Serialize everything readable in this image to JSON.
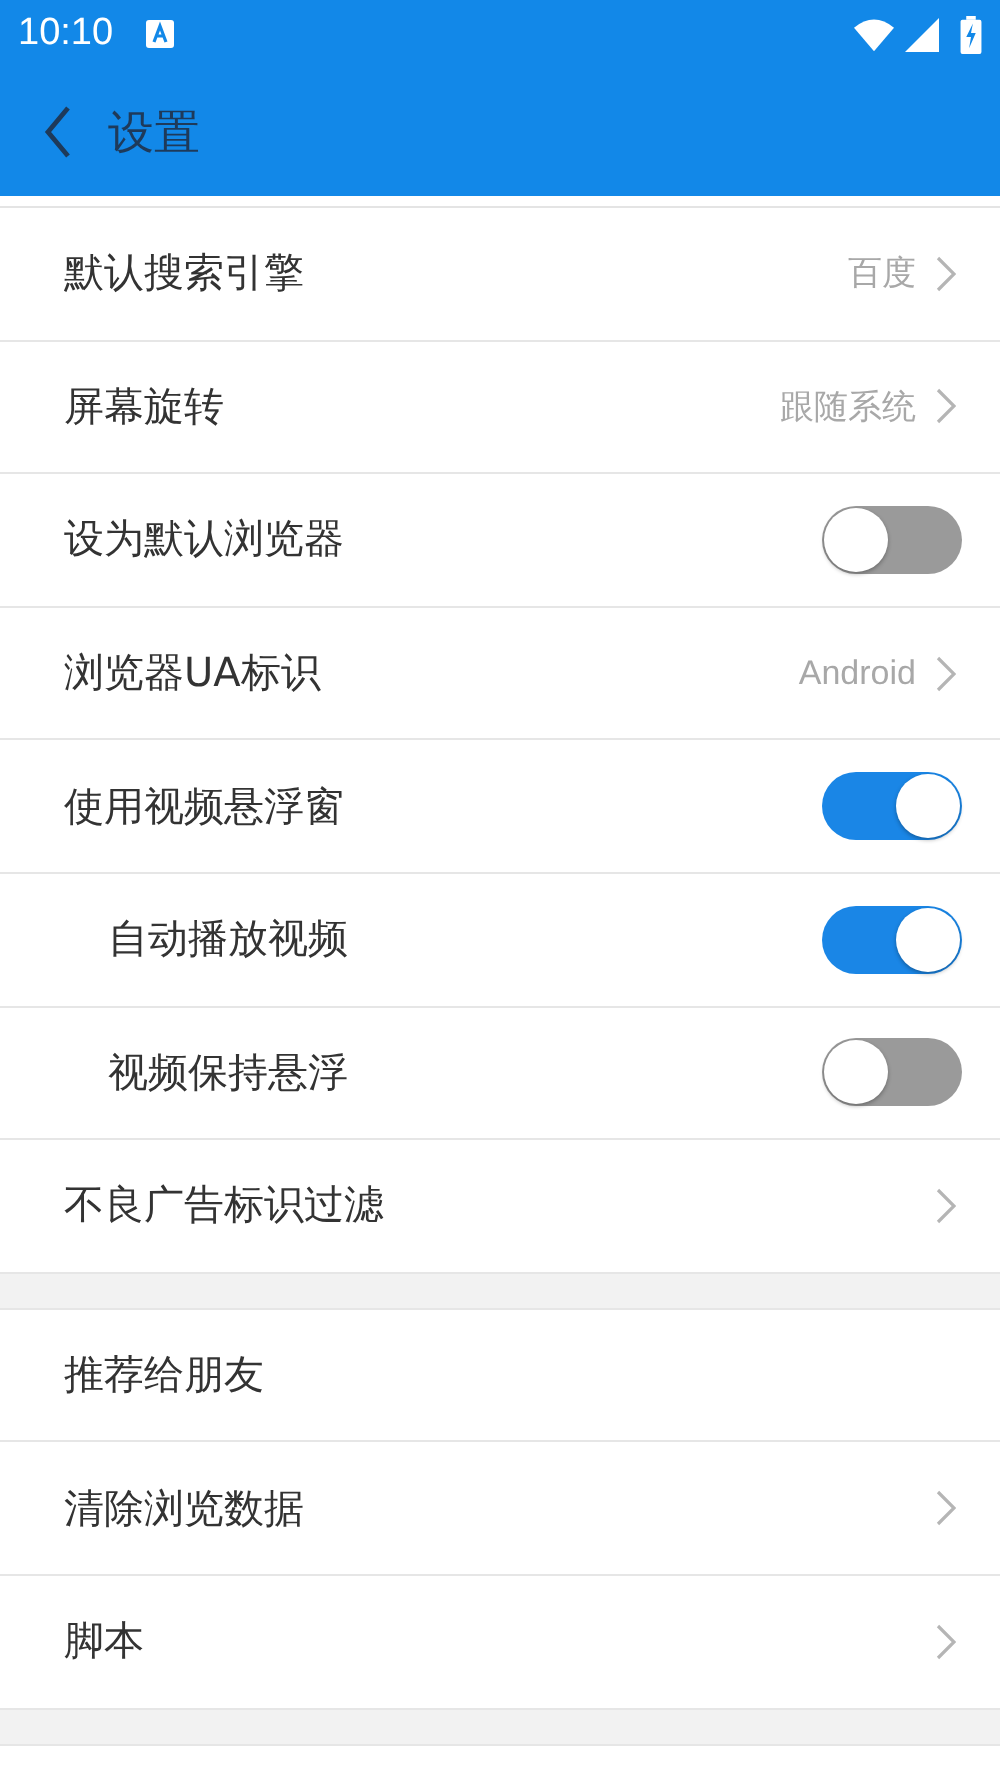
{
  "status_bar": {
    "time": "10:10"
  },
  "toolbar": {
    "title": "设置"
  },
  "sections": [
    {
      "items": [
        {
          "kind": "nav",
          "label": "默认搜索引擎",
          "value": "百度"
        },
        {
          "kind": "nav",
          "label": "屏幕旋转",
          "value": "跟随系统"
        },
        {
          "kind": "toggle",
          "label": "设为默认浏览器",
          "on": false
        },
        {
          "kind": "nav",
          "label": "浏览器UA标识",
          "value": "Android"
        },
        {
          "kind": "toggle",
          "label": "使用视频悬浮窗",
          "on": true,
          "children": [
            {
              "kind": "toggle",
              "label": "自动播放视频",
              "on": true
            },
            {
              "kind": "toggle",
              "label": "视频保持悬浮",
              "on": false
            }
          ]
        },
        {
          "kind": "nav",
          "label": "不良广告标识过滤"
        }
      ]
    },
    {
      "items": [
        {
          "kind": "plain",
          "label": "推荐给朋友"
        },
        {
          "kind": "nav",
          "label": "清除浏览数据"
        },
        {
          "kind": "nav",
          "label": "脚本"
        }
      ]
    }
  ]
}
